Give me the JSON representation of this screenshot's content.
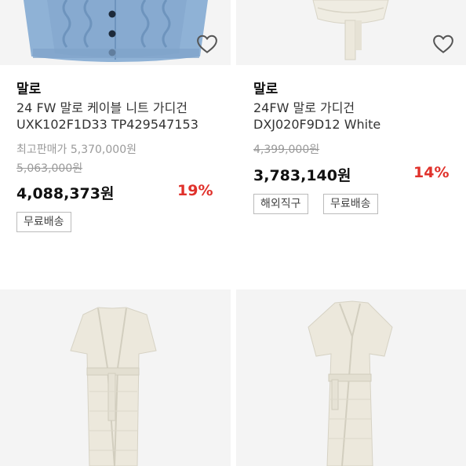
{
  "products": [
    {
      "brand": "말로",
      "name_line1": "24 FW 말로 케이블 니트 가디건",
      "name_line2": "UXK102F1D33 TP429547153",
      "max_price_label": "최고판매가 5,370,000원",
      "original_price": "5,063,000원",
      "price": "4,088,373원",
      "discount": "19%",
      "tags": [
        "무료배송"
      ]
    },
    {
      "brand": "말로",
      "name_line1": "24FW 말로 가디건",
      "name_line2": "DXJ020F9D12 White",
      "original_price": "4,399,000원",
      "price": "3,783,140원",
      "discount": "14%",
      "tags": [
        "해외직구",
        "무료배송"
      ]
    }
  ],
  "icons": {
    "wishlist": "heart-outline-icon"
  },
  "colors": {
    "discount": "#e0312b",
    "image_bg": "#f4f4f4"
  }
}
